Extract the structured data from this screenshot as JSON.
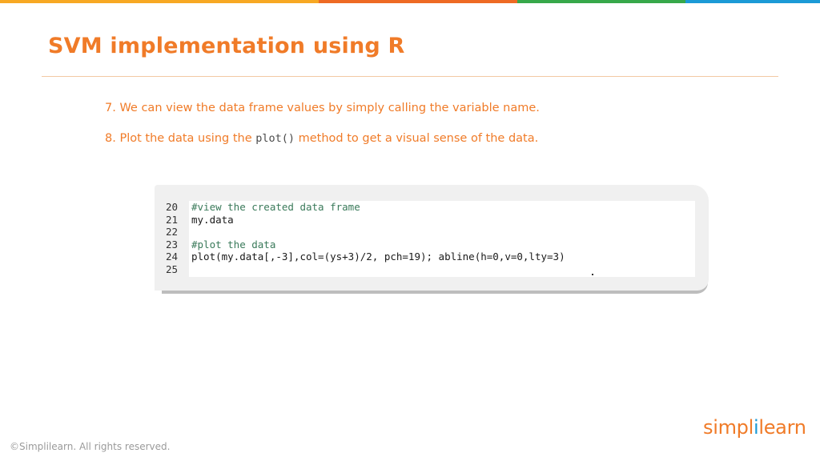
{
  "colors": {
    "accent": "#f07b28",
    "topbar": [
      "#f7a823",
      "#ee6a24",
      "#37a84a",
      "#1b9ad6"
    ]
  },
  "slide": {
    "title": "SVM implementation using R",
    "points": [
      {
        "before": "7. We can view the data frame values by simply calling the variable name.",
        "code": "",
        "after": ""
      },
      {
        "before": "8. Plot the data using the ",
        "code": "plot()",
        "after": " method to get a visual sense of the data."
      }
    ]
  },
  "code_panel": {
    "lines": [
      {
        "number": "20",
        "text": "#view the created data frame",
        "comment": true
      },
      {
        "number": "21",
        "text": "my.data",
        "comment": false
      },
      {
        "number": "22",
        "text": "",
        "comment": false
      },
      {
        "number": "23",
        "text": "#plot the data",
        "comment": true
      },
      {
        "number": "24",
        "text": "plot(my.data[,-3],col=(ys+3)/2, pch=19); abline(h=0,v=0,lty=3)",
        "comment": false
      },
      {
        "number": "25",
        "text": "",
        "comment": false
      }
    ]
  },
  "footer": {
    "copyright": "©Simplilearn. All rights reserved.",
    "logo_part1": "simpl",
    "logo_part2": "i",
    "logo_part3": "learn"
  }
}
